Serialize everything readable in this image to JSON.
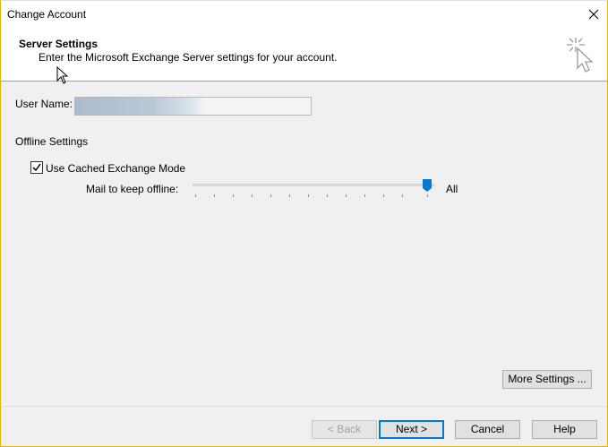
{
  "window": {
    "title": "Change Account"
  },
  "header": {
    "title": "Server Settings",
    "subtitle": "Enter the Microsoft Exchange Server settings for your account."
  },
  "fields": {
    "user_name_label": "User Name:",
    "user_name_value": ""
  },
  "offline": {
    "section_label": "Offline Settings",
    "cached_mode_label": "Use Cached Exchange Mode",
    "cached_mode_checked": true,
    "mail_keep_label": "Mail to keep offline:",
    "mail_keep_value": "All"
  },
  "buttons": {
    "more_settings": "More Settings ...",
    "back": "< Back",
    "next": "Next >",
    "cancel": "Cancel",
    "help": "Help"
  }
}
